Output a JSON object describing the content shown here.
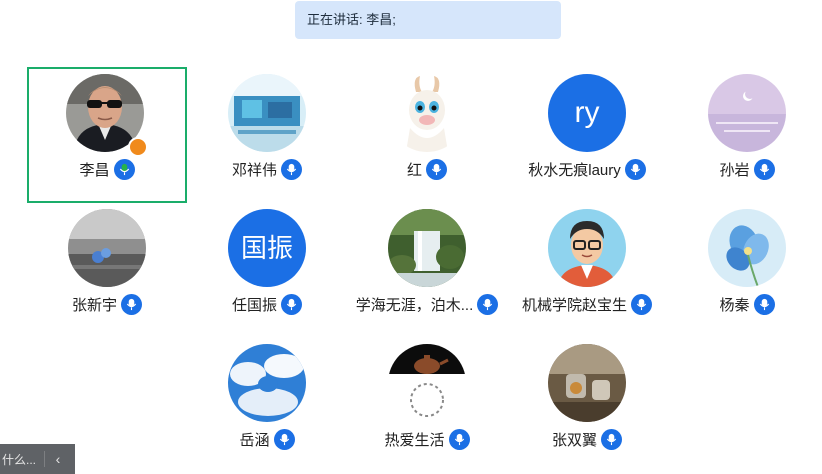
{
  "banner": {
    "text": "正在讲话: 李昌;"
  },
  "participants": [
    {
      "name": "李昌",
      "active": true,
      "host": true
    },
    {
      "name": "邓祥伟"
    },
    {
      "name": "红"
    },
    {
      "name": "秋水无痕laury",
      "avatar_text": "ry"
    },
    {
      "name": "孙岩"
    },
    {
      "name": "张新宇"
    },
    {
      "name": "任国振",
      "avatar_text": "国振"
    },
    {
      "name": "学海无涯，泊木..."
    },
    {
      "name": "机械学院赵宝生"
    },
    {
      "name": "杨秦"
    },
    {
      "name": "岳涵"
    },
    {
      "name": "热爱生活"
    },
    {
      "name": "张双翼"
    }
  ],
  "bottom_bar": {
    "text": "什么...",
    "collapse_icon": "chevron-left-icon"
  },
  "colors": {
    "accent": "#1b6fe5",
    "active_border": "#1aad6a",
    "active_mic": "#27b24a",
    "banner_bg": "#d6e6fb"
  }
}
